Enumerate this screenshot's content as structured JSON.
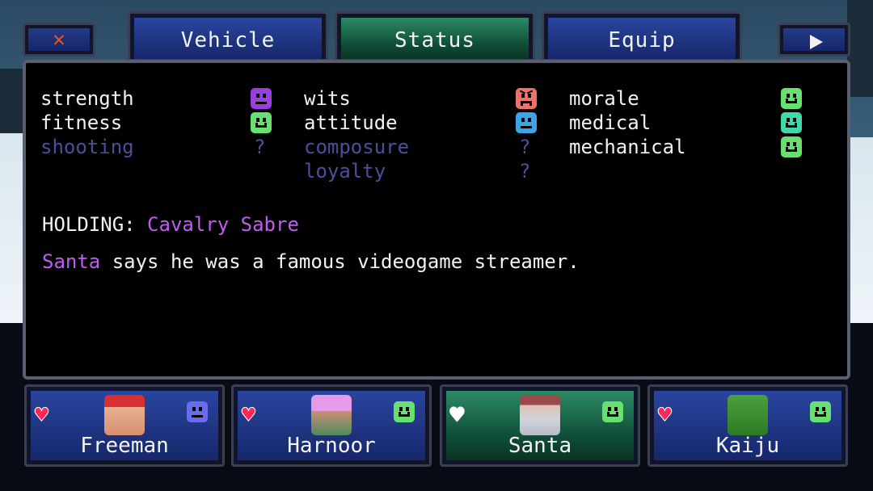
{
  "colors": {
    "accent_purple": "#c15cf0",
    "unknown_stat": "#4e4e9a",
    "tab_active": "#0e4a34",
    "tab_inactive": "#16276a",
    "close_x": "#e8542a",
    "heart": "#ff2a5a"
  },
  "toolbar": {
    "close_icon": "close-x-icon",
    "next_icon": "play-arrow-icon"
  },
  "tabs": [
    {
      "label": "Vehicle",
      "active": false
    },
    {
      "label": "Status",
      "active": true
    },
    {
      "label": "Equip",
      "active": false
    }
  ],
  "stats": {
    "col1": [
      {
        "label": "strength",
        "mood": "neutral",
        "color": "#9b3ee0",
        "known": true
      },
      {
        "label": "fitness",
        "mood": "happy",
        "color": "#68e070",
        "known": true
      },
      {
        "label": "shooting",
        "mood": "unknown",
        "value": "?",
        "known": false
      }
    ],
    "col2": [
      {
        "label": "wits",
        "mood": "angry",
        "color": "#f0706a",
        "known": true
      },
      {
        "label": "attitude",
        "mood": "neutral",
        "color": "#3aa6e8",
        "known": true
      },
      {
        "label": "composure",
        "mood": "unknown",
        "value": "?",
        "known": false
      },
      {
        "label": "loyalty",
        "mood": "unknown",
        "value": "?",
        "known": false
      }
    ],
    "col3": [
      {
        "label": "morale",
        "mood": "happy",
        "color": "#68e070",
        "known": true
      },
      {
        "label": "medical",
        "mood": "happy",
        "color": "#3fd8a8",
        "known": true
      },
      {
        "label": "mechanical",
        "mood": "happy",
        "color": "#68e070",
        "known": true
      }
    ]
  },
  "holding": {
    "label": "HOLDING:",
    "item": "Cavalry Sabre"
  },
  "dialogue": {
    "speaker": "Santa",
    "text": "says he was a famous videogame streamer."
  },
  "party": [
    {
      "name": "Freeman",
      "heart": "full",
      "mood": "neutral",
      "mood_color": "#6a6cf0",
      "active": false,
      "portrait": "man-red-cap"
    },
    {
      "name": "Harnoor",
      "heart": "full",
      "mood": "happy",
      "mood_color": "#68e070",
      "active": false,
      "portrait": "person-pink-hat"
    },
    {
      "name": "Santa",
      "heart": "empty",
      "mood": "happy",
      "mood_color": "#68e070",
      "active": true,
      "portrait": "santa-gray-beard"
    },
    {
      "name": "Kaiju",
      "heart": "full",
      "mood": "happy",
      "mood_color": "#68e070",
      "active": false,
      "portrait": "green-monster"
    }
  ]
}
